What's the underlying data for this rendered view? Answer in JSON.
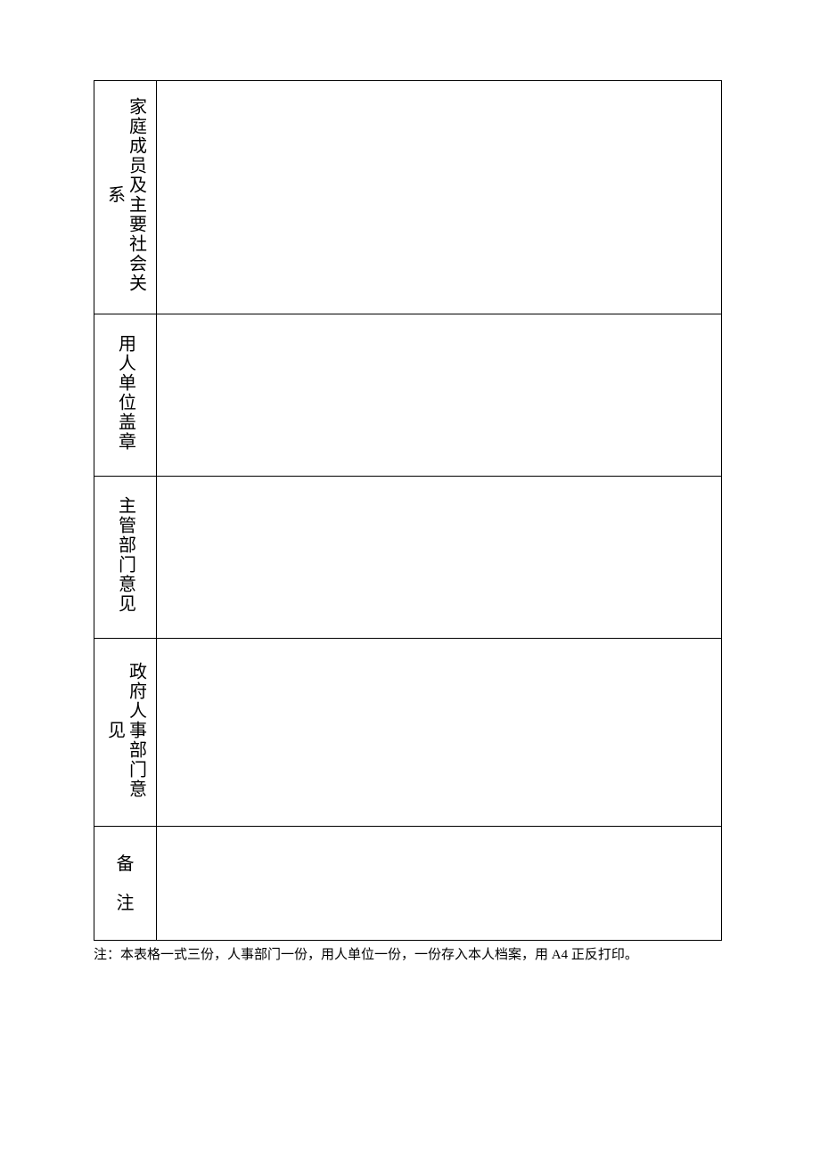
{
  "form": {
    "rows": [
      {
        "label": "家庭成员及主要社会关系",
        "content": ""
      },
      {
        "label": "用人单位盖章",
        "content": ""
      },
      {
        "label": "主管部门意见",
        "content": ""
      },
      {
        "label": "政府人事部门意见",
        "content": ""
      },
      {
        "label_line1": "备",
        "label_line2": "注",
        "content": ""
      }
    ]
  },
  "footnote": "注：本表格一式三份，人事部门一份，用人单位一份，一份存入本人档案，用 A4 正反打印。"
}
